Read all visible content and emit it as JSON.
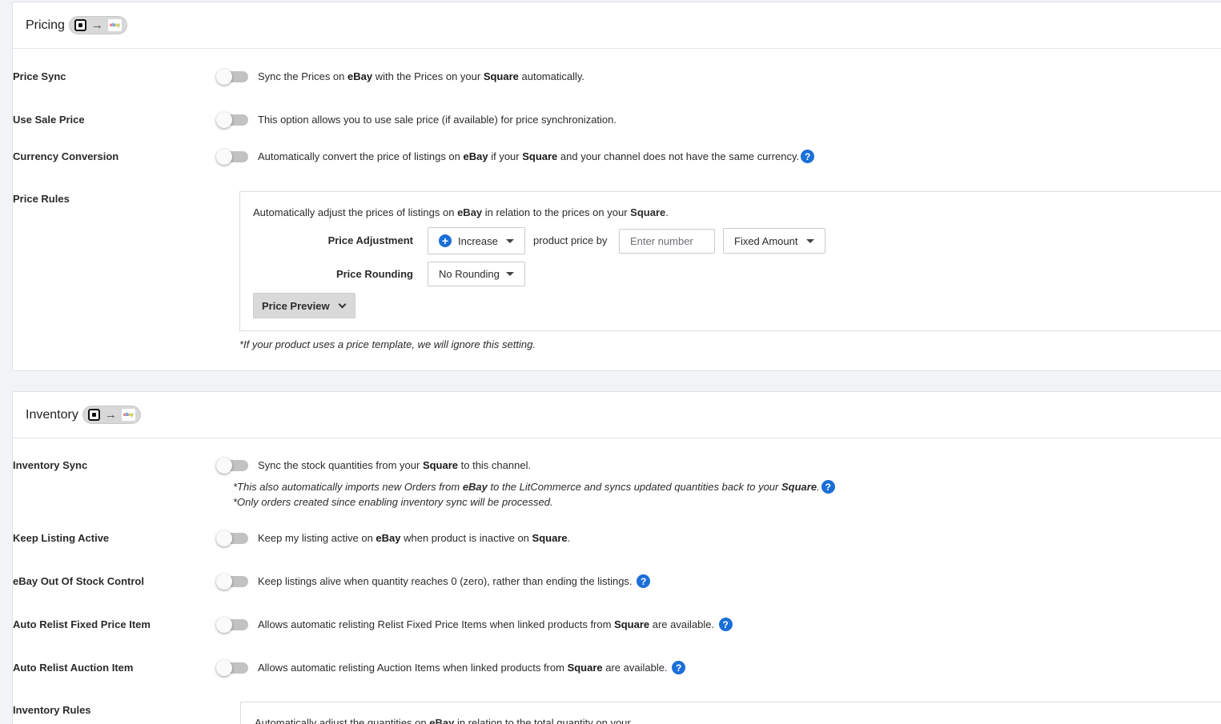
{
  "pricing": {
    "title": "Pricing",
    "rows": {
      "price_sync": {
        "label": "Price Sync",
        "desc_pre": "Sync the Prices on ",
        "desc_b1": "eBay",
        "desc_mid": " with the Prices on your ",
        "desc_b2": "Square",
        "desc_post": " automatically."
      },
      "use_sale_price": {
        "label": "Use Sale Price",
        "desc": "This option allows you to use sale price (if available) for price synchronization."
      },
      "currency_conversion": {
        "label": "Currency Conversion",
        "desc_pre": "Automatically convert the price of listings on ",
        "desc_b1": "eBay",
        "desc_mid": " if your ",
        "desc_b2": "Square",
        "desc_post": " and your channel does not have the same currency."
      },
      "price_rules": {
        "label": "Price Rules"
      }
    },
    "rules": {
      "intro_pre": "Automatically adjust the prices of listings on ",
      "intro_b1": "eBay",
      "intro_mid": " in relation to the prices on your ",
      "intro_b2": "Square",
      "intro_post": ".",
      "adjustment_label": "Price Adjustment",
      "adjustment_value": "Increase",
      "product_price_by": "product price by",
      "amount_placeholder": "Enter number",
      "amount_type": "Fixed Amount",
      "rounding_label": "Price Rounding",
      "rounding_value": "No Rounding",
      "preview_label": "Price Preview",
      "note": "*If your product uses a price template, we will ignore this setting."
    }
  },
  "inventory": {
    "title": "Inventory",
    "rows": {
      "inventory_sync": {
        "label": "Inventory Sync",
        "desc_pre": "Sync the stock quantities from your ",
        "desc_b1": "Square",
        "desc_post": " to this channel.",
        "note1_pre": "*This also automatically imports new Orders from ",
        "note1_b1": "eBay",
        "note1_mid": " to the LitCommerce and syncs updated quantities back to your ",
        "note1_b2": "Square",
        "note1_post": ".",
        "note2": "*Only orders created since enabling inventory sync will be processed."
      },
      "keep_listing_active": {
        "label": "Keep Listing Active",
        "desc_pre": "Keep my listing active on ",
        "desc_b1": "eBay",
        "desc_mid": " when product is inactive on ",
        "desc_b2": "Square",
        "desc_post": "."
      },
      "out_of_stock": {
        "label": "eBay Out Of Stock Control",
        "desc": "Keep listings alive when quantity reaches 0 (zero), rather than ending the listings."
      },
      "relist_fixed": {
        "label": "Auto Relist Fixed Price Item",
        "desc_pre": "Allows automatic relisting Relist Fixed Price Items when linked products from ",
        "desc_b1": "Square",
        "desc_post": " are available."
      },
      "relist_auction": {
        "label": "Auto Relist Auction Item",
        "desc_pre": "Allows automatic relisting Auction Items when linked products from ",
        "desc_b1": "Square",
        "desc_post": " are available."
      },
      "inventory_rules": {
        "label": "Inventory Rules",
        "desc_pre": "Automatically adjust the quantities on ",
        "desc_b1": "eBay",
        "desc_post": " in relation to the total quantity on your"
      }
    }
  },
  "icons": {
    "help": "?",
    "plus": "+",
    "arrow": "→"
  },
  "colors": {
    "accent": "#1b6fd8",
    "page_bg": "#f1f3f6"
  }
}
